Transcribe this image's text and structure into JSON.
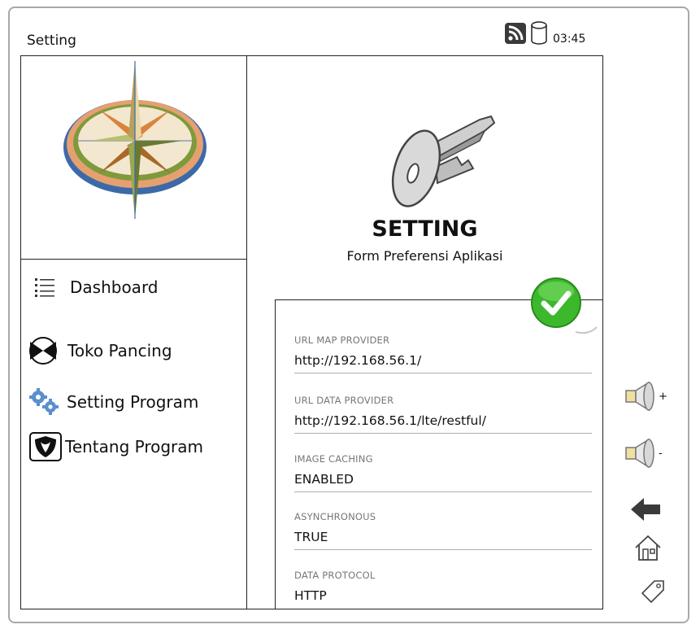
{
  "window": {
    "title": "Setting"
  },
  "status_bar": {
    "time": "03:45",
    "icons": [
      "rss-icon",
      "database-icon"
    ]
  },
  "sidebar": {
    "items": [
      {
        "label": "Dashboard",
        "icon": "list-icon"
      },
      {
        "label": "Toko Pancing",
        "icon": "fish-icon"
      },
      {
        "label": "Setting Program",
        "icon": "gears-icon"
      },
      {
        "label": "Tentang Program",
        "icon": "shield-icon"
      }
    ]
  },
  "main": {
    "heading": "SETTING",
    "subheading": "Form Preferensi Aplikasi",
    "form": {
      "fields": [
        {
          "label": "URL MAP PROVIDER",
          "value": "http://192.168.56.1/"
        },
        {
          "label": "URL DATA PROVIDER",
          "value": "http://192.168.56.1/lte/restful/"
        },
        {
          "label": "IMAGE CACHING",
          "value": "ENABLED"
        },
        {
          "label": "ASYNCHRONOUS",
          "value": "TRUE"
        },
        {
          "label": "DATA PROTOCOL",
          "value": "HTTP"
        }
      ]
    }
  },
  "side_controls": {
    "volume_up_suffix": "+",
    "volume_down_suffix": "-"
  },
  "colors": {
    "confirm_green": "#3cb82c",
    "border": "#222222"
  }
}
